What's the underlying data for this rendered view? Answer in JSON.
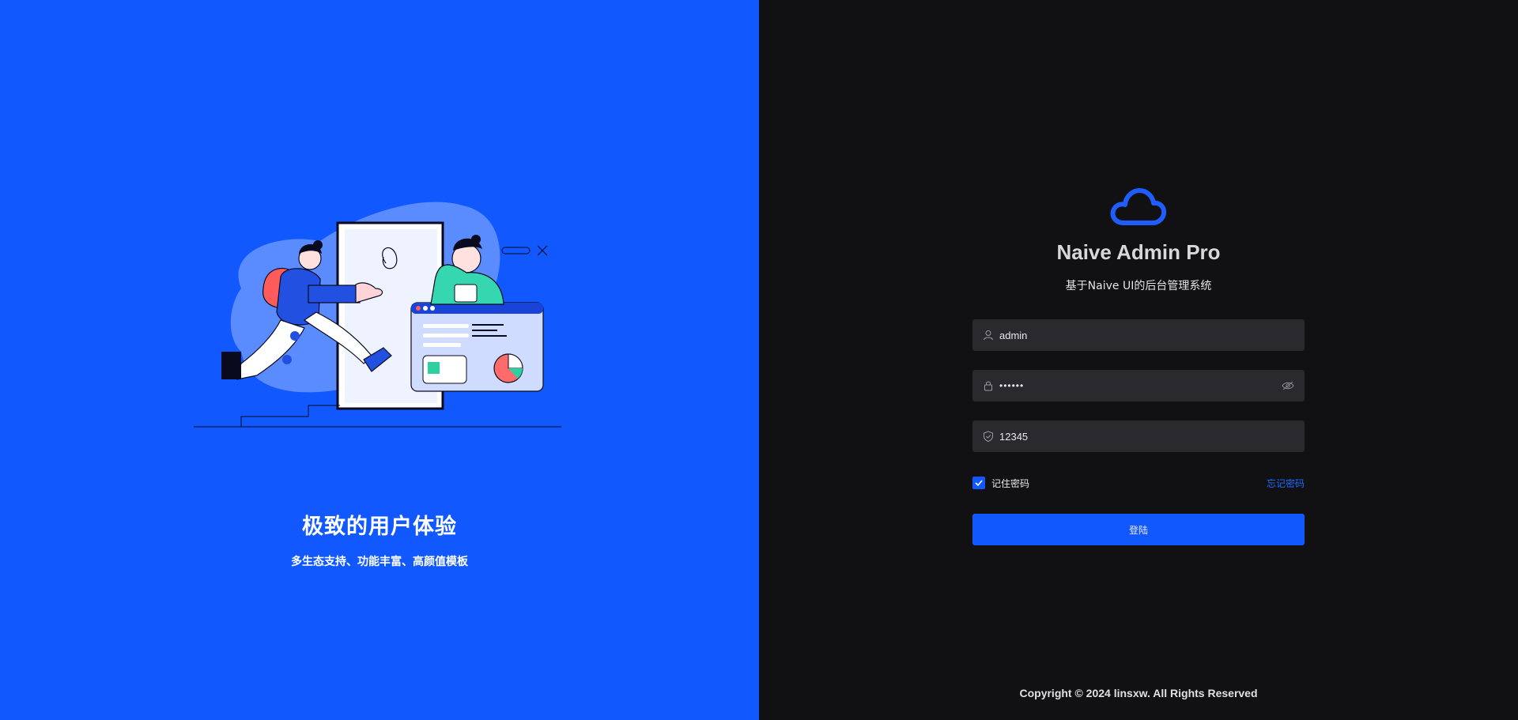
{
  "left": {
    "headline": "极致的用户体验",
    "subheadline": "多生态支持、功能丰富、高颜值模板"
  },
  "brand": {
    "title": "Naive Admin Pro",
    "subtitle": "基于Naive UI的后台管理系统",
    "logo_icon": "cloud-icon"
  },
  "form": {
    "username": {
      "value": "admin",
      "icon": "user-icon"
    },
    "password": {
      "value": "••••••",
      "icon": "lock-icon",
      "toggle_icon": "eye-icon"
    },
    "captcha": {
      "value": "12345",
      "icon": "shield-icon"
    },
    "remember": {
      "label": "记住密码",
      "checked": true
    },
    "forgot_label": "忘记密码",
    "submit_label": "登陆"
  },
  "footer": {
    "copyright": "Copyright © 2024 linsxw. All Rights Reserved"
  },
  "colors": {
    "primary": "#1159ff",
    "dark_bg": "#111114",
    "field_bg": "#2a2a2e"
  }
}
